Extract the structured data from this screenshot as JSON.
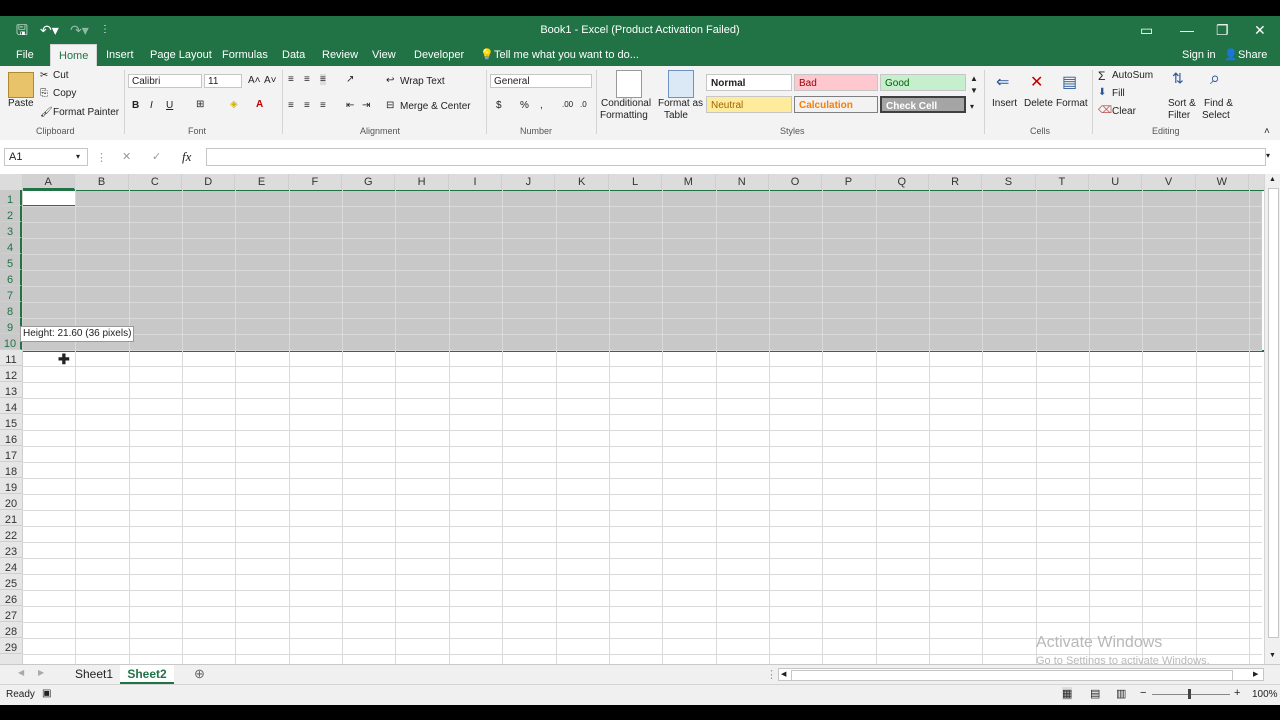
{
  "title_bar": {
    "title": "Book1 - Excel (Product Activation Failed)",
    "controls": [
      "save-icon",
      "undo-icon",
      "redo-icon",
      "customize-icon"
    ]
  },
  "menu": {
    "items": [
      "File",
      "Home",
      "Insert",
      "Page Layout",
      "Formulas",
      "Data",
      "Review",
      "View",
      "Developer"
    ],
    "active": "Home",
    "tell_me": "Tell me what you want to do...",
    "sign_in": "Sign in",
    "share": "Share"
  },
  "ribbon": {
    "clipboard": {
      "paste": "Paste",
      "cut": "Cut",
      "copy": "Copy",
      "format_painter": "Format Painter",
      "label": "Clipboard"
    },
    "font": {
      "name": "Calibri",
      "size": "11",
      "bold": "B",
      "italic": "I",
      "underline": "U",
      "label": "Font"
    },
    "alignment": {
      "wrap_text": "Wrap Text",
      "merge_center": "Merge & Center",
      "label": "Alignment"
    },
    "number": {
      "format": "General",
      "currency": "$",
      "percent": "%",
      "comma": ",",
      "label": "Number"
    },
    "styles": {
      "conditional": [
        "Conditional",
        "Formatting"
      ],
      "format_as_table": [
        "Format as",
        "Table"
      ],
      "normal": "Normal",
      "bad": "Bad",
      "good": "Good",
      "neutral": "Neutral",
      "calculation": "Calculation",
      "check_cell": "Check Cell",
      "label": "Styles"
    },
    "cells": {
      "insert": "Insert",
      "delete": "Delete",
      "format": "Format",
      "label": "Cells"
    },
    "editing": {
      "autosum": "AutoSum",
      "fill": "Fill",
      "clear": "Clear",
      "sort_filter": [
        "Sort &",
        "Filter"
      ],
      "find_select": [
        "Find &",
        "Select"
      ],
      "label": "Editing"
    }
  },
  "formula_bar": {
    "name_box": "A1",
    "fx": "fx",
    "value": ""
  },
  "grid": {
    "columns": [
      "A",
      "B",
      "C",
      "D",
      "E",
      "F",
      "G",
      "H",
      "I",
      "J",
      "K",
      "L",
      "M",
      "N",
      "O",
      "P",
      "Q",
      "R",
      "S",
      "T",
      "U",
      "V",
      "W"
    ],
    "rows": [
      "1",
      "2",
      "3",
      "4",
      "5",
      "6",
      "7",
      "8",
      "9",
      "10",
      "11",
      "12",
      "13",
      "14",
      "15",
      "16",
      "17",
      "18",
      "19",
      "20",
      "21",
      "22",
      "23",
      "24",
      "25",
      "26",
      "27",
      "28",
      "29"
    ],
    "tooltip": "Height: 21.60 (36 pixels)",
    "watermark": [
      "Activate Windows",
      "Go to Settings to activate Windows."
    ]
  },
  "sheets": {
    "tabs": [
      "Sheet1",
      "Sheet2"
    ],
    "active": "Sheet2"
  },
  "status": {
    "ready": "Ready",
    "zoom": "100%"
  },
  "colors": {
    "accent": "#217346",
    "selection": "#c6c6c6"
  }
}
